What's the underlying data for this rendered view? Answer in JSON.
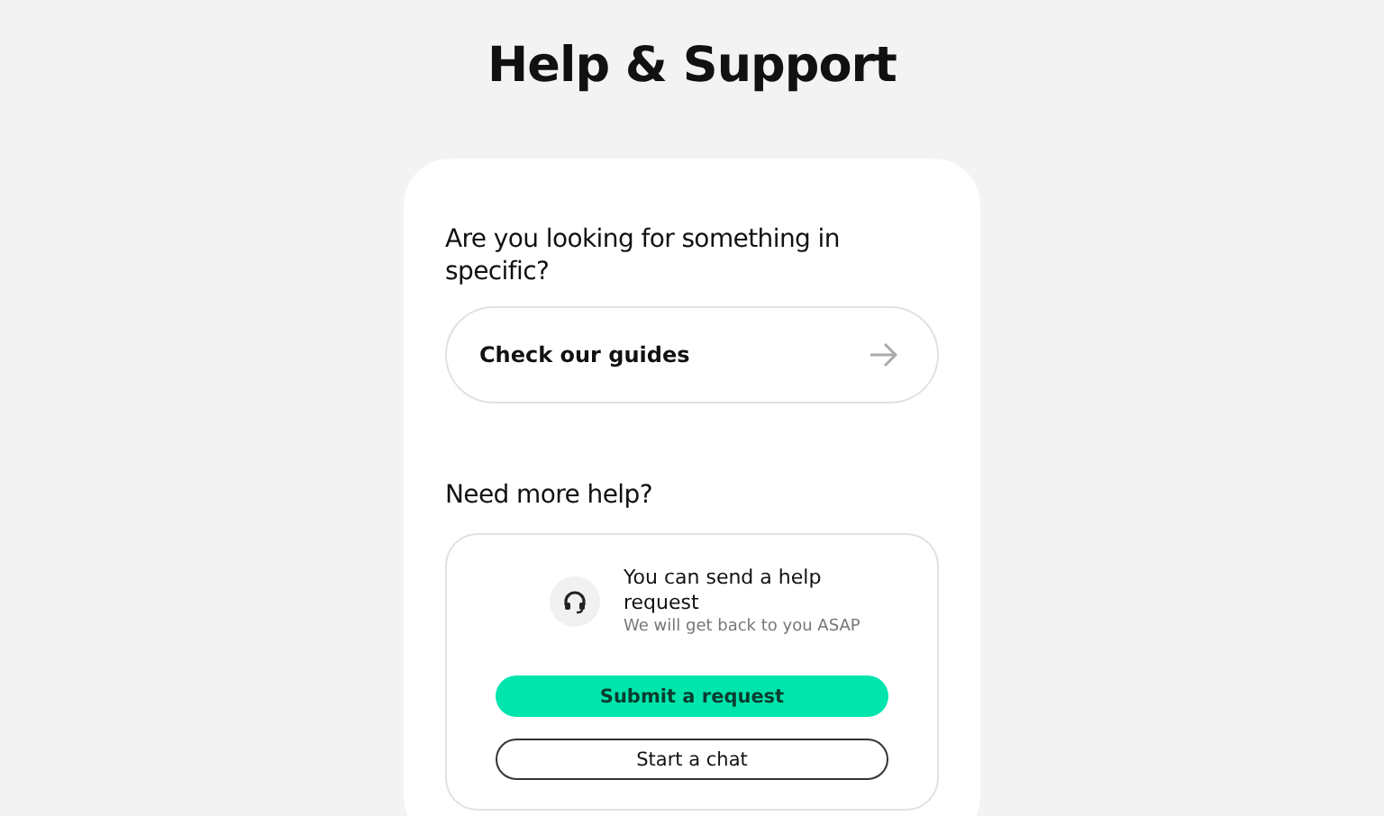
{
  "title": "Help & Support",
  "guides": {
    "question": "Are you looking for something in specific?",
    "link": "Check our guides"
  },
  "more_help": {
    "heading": "Need more help?",
    "title": "You can send a help request",
    "subtitle": "We will get back to you ASAP",
    "buttons": [
      {
        "label": "Submit a request",
        "kind": "primary"
      },
      {
        "label": "Start a chat",
        "kind": "outline"
      }
    ]
  }
}
